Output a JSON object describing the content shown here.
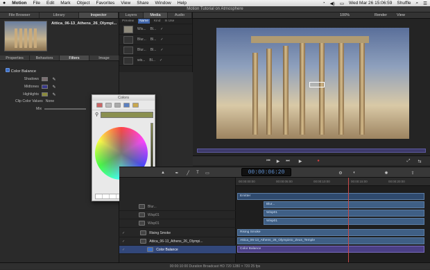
{
  "menubar": {
    "apple": "",
    "app": "Motion",
    "items": [
      "File",
      "Edit",
      "Mark",
      "Object",
      "Favorites",
      "View",
      "Share",
      "Window",
      "Help"
    ],
    "clock": "Wed Mar 26  15:06:59",
    "user": "Shuffle"
  },
  "window": {
    "title": "Motion Tutorial on Atmosphere"
  },
  "left_tabs": [
    "File Browser",
    "Library",
    "Inspector"
  ],
  "clip": {
    "name": "Attica_06-13_Athens_26_Olympi..."
  },
  "inspector_tabs": [
    "Properties",
    "Behaviors",
    "Filters",
    "Image"
  ],
  "filter": {
    "name": "Color Balance",
    "rows": [
      {
        "label": "Shadows"
      },
      {
        "label": "Midtones"
      },
      {
        "label": "Highlights"
      }
    ],
    "clip_label": "Clip Color Values",
    "clip_value": "None",
    "mix_label": "Mix"
  },
  "colors": {
    "title": "Colors"
  },
  "layers": {
    "tabs": [
      "Layers",
      "Media",
      "Audio"
    ],
    "cols": [
      "Preview",
      "Name",
      "Kind",
      "In Use"
    ],
    "rows": [
      {
        "name": "Wis...",
        "kind": "Bl..."
      },
      {
        "name": "Blur...",
        "kind": "Bl..."
      },
      {
        "name": "Blur...",
        "kind": "Bl..."
      },
      {
        "name": "wis...",
        "kind": "Bl..."
      }
    ]
  },
  "viewer": {
    "zoom": "100%",
    "render": "Render",
    "view": "View"
  },
  "timecode": "00:00:06:20",
  "timeline_left": [
    {
      "name": "Blur..."
    },
    {
      "name": "Wisp01"
    },
    {
      "name": "Wisp01"
    },
    {
      "name": "Rising Smoke"
    },
    {
      "name": "Attica_06-13_Athens_26_Olympi..."
    },
    {
      "name": "Color Balance"
    }
  ],
  "timeline_bars": [
    {
      "label": "Emitter"
    },
    {
      "label": "Blur..."
    },
    {
      "label": "Wisp01"
    },
    {
      "label": "Wisp01"
    },
    {
      "label": "Rising Smoke"
    },
    {
      "label": "Attica_06-13_Athens_26_Olympieio_Zeus_Temple"
    },
    {
      "label": "Color Balance"
    }
  ],
  "ruler": [
    "00:00:00:00",
    "00:00:05:00",
    "00:00:10:00",
    "00:00:15:00",
    "00:00:20:00"
  ],
  "status": "00:00:10:00  Duration  Broadcast HD 720  1280 × 720  25 fps"
}
